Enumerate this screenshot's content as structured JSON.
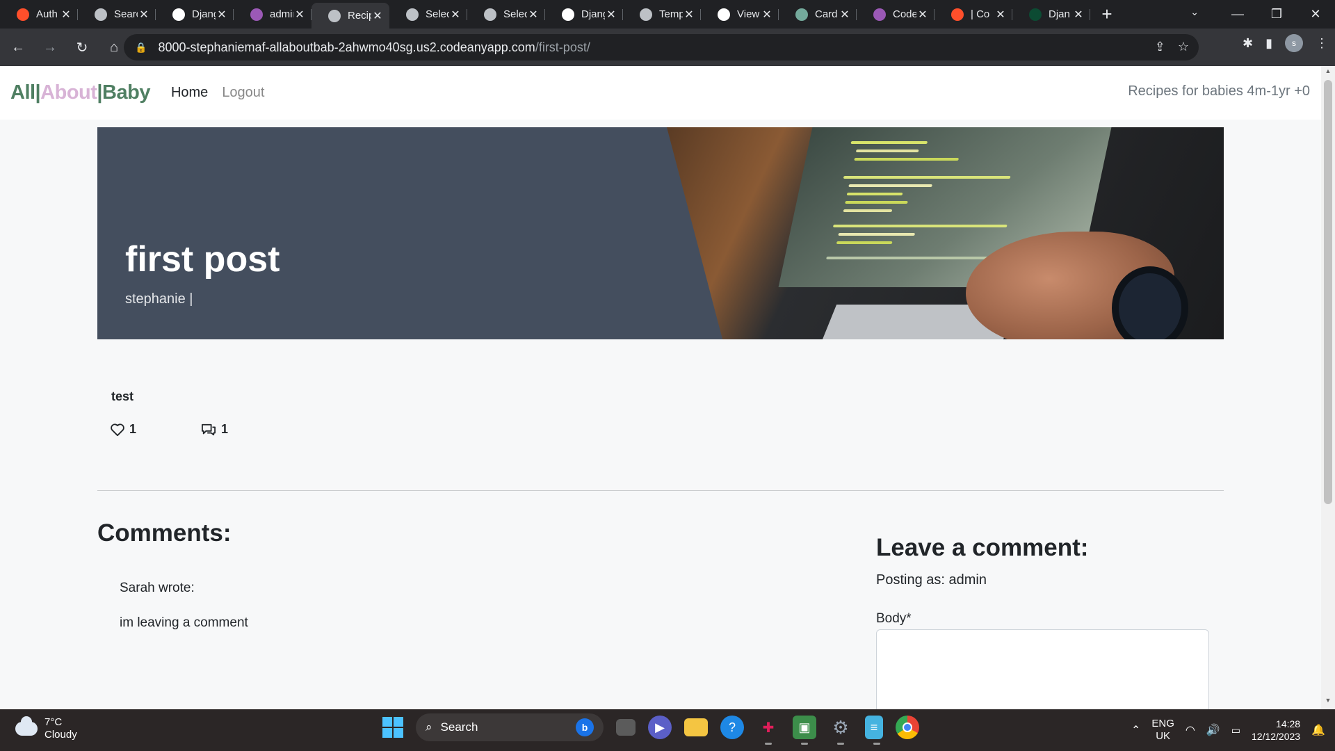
{
  "browser": {
    "tabs": [
      {
        "title": "Auth",
        "icon": "opera-icon",
        "color": "#ff4f2b"
      },
      {
        "title": "Search",
        "icon": "book-icon",
        "color": "#bdc1c6"
      },
      {
        "title": "Django",
        "icon": "github-icon",
        "color": "#ffffff"
      },
      {
        "title": "admin",
        "icon": "codeanywhere-icon",
        "color": "#9b59b6"
      },
      {
        "title": "Recipes",
        "icon": "globe-icon",
        "color": "#bdc1c6"
      },
      {
        "title": "Select",
        "icon": "globe-icon",
        "color": "#bdc1c6"
      },
      {
        "title": "Select",
        "icon": "globe-icon",
        "color": "#bdc1c6"
      },
      {
        "title": "Django",
        "icon": "github-icon",
        "color": "#ffffff"
      },
      {
        "title": "Temp",
        "icon": "globe-icon",
        "color": "#bdc1c6"
      },
      {
        "title": "View",
        "icon": "github-icon",
        "color": "#ffffff"
      },
      {
        "title": "Card",
        "icon": "chatgpt-icon",
        "color": "#74aa9c"
      },
      {
        "title": "Code",
        "icon": "codeanywhere-icon",
        "color": "#9b59b6"
      },
      {
        "title": "| Co",
        "icon": "opera-icon",
        "color": "#ff4f2b"
      },
      {
        "title": "Djan",
        "icon": "django-icon",
        "color": "#0c4b33"
      }
    ],
    "active_tab_index": 4,
    "url_host": "8000-stephaniemaf-allaboutbab-2ahwmo40sg.us2.codeanyapp.com",
    "url_path": "/first-post/",
    "profile_initial": "s"
  },
  "site": {
    "brand": {
      "part1": "All|",
      "part2": "About",
      "part3": "|Baby"
    },
    "nav": {
      "home": "Home",
      "logout": "Logout"
    },
    "tagline": "Recipes for babies 4m-1yr +0"
  },
  "post": {
    "title": "first post",
    "author_line": "stephanie |",
    "body": "test",
    "likes": "1",
    "comments_count": "1"
  },
  "comments": {
    "heading": "Comments:",
    "items": [
      {
        "author_line": "Sarah wrote:",
        "text": "im leaving a comment"
      }
    ]
  },
  "comment_form": {
    "heading": "Leave a comment:",
    "posting_as": "Posting as: admin",
    "body_label": "Body*",
    "body_value": ""
  },
  "taskbar": {
    "weather_temp": "7°C",
    "weather_desc": "Cloudy",
    "search_label": "Search",
    "lang_top": "ENG",
    "lang_bottom": "UK",
    "time": "14:28",
    "date": "12/12/2023"
  },
  "colors": {
    "brand_green": "#4f7f62",
    "brand_pink": "#d8b3d6",
    "hero_bg": "#444e5e",
    "chrome_dark": "#202124"
  }
}
